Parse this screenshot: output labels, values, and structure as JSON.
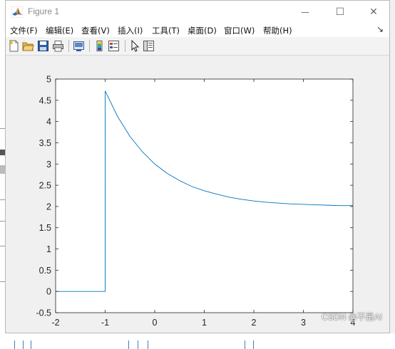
{
  "window": {
    "title": "Figure 1",
    "minimize_glyph": "—",
    "maximize_glyph": "☐",
    "close_glyph": "✕",
    "app_icon": "matlab-logo-icon"
  },
  "menu": {
    "items": [
      {
        "label": "文件(F)"
      },
      {
        "label": "编辑(E)"
      },
      {
        "label": "查看(V)"
      },
      {
        "label": "插入(I)"
      },
      {
        "label": "工具(T)"
      },
      {
        "label": "桌面(D)"
      },
      {
        "label": "窗口(W)"
      },
      {
        "label": "帮助(H)"
      }
    ],
    "dock_arrow": "↘"
  },
  "toolbar": {
    "buttons": [
      {
        "icon": "new-figure-icon"
      },
      {
        "icon": "open-file-icon"
      },
      {
        "icon": "save-icon"
      },
      {
        "icon": "print-icon"
      },
      {
        "icon": "link-figure-icon"
      },
      {
        "icon": "colorbar-icon"
      },
      {
        "icon": "legend-icon"
      },
      {
        "icon": "edit-plot-pointer-icon"
      },
      {
        "icon": "property-inspector-icon"
      }
    ]
  },
  "chart_data": {
    "type": "line",
    "title": "",
    "xlabel": "",
    "ylabel": "",
    "xlim": [
      -2,
      4
    ],
    "ylim": [
      -0.5,
      5
    ],
    "xticks": [
      "-2",
      "-1",
      "0",
      "1",
      "2",
      "3",
      "4"
    ],
    "yticks": [
      "-0.5",
      "0",
      "0.5",
      "1",
      "1.5",
      "2",
      "2.5",
      "3",
      "3.5",
      "4",
      "4.5",
      "5"
    ],
    "grid": false,
    "line_color": "#0072BD",
    "series": [
      {
        "x": [
          -2,
          -1,
          -1,
          -0.75,
          -0.5,
          -0.25,
          0,
          0.25,
          0.5,
          0.75,
          1,
          1.25,
          1.5,
          1.75,
          2,
          2.25,
          2.5,
          2.75,
          3,
          3.25,
          3.5,
          3.75,
          4
        ],
        "y": [
          0,
          0,
          4.72,
          4.12,
          3.65,
          3.29,
          3.0,
          2.78,
          2.61,
          2.47,
          2.37,
          2.29,
          2.22,
          2.17,
          2.13,
          2.1,
          2.08,
          2.06,
          2.05,
          2.04,
          2.03,
          2.02,
          2.02
        ]
      }
    ]
  },
  "watermark": "CSDN @不是AI"
}
